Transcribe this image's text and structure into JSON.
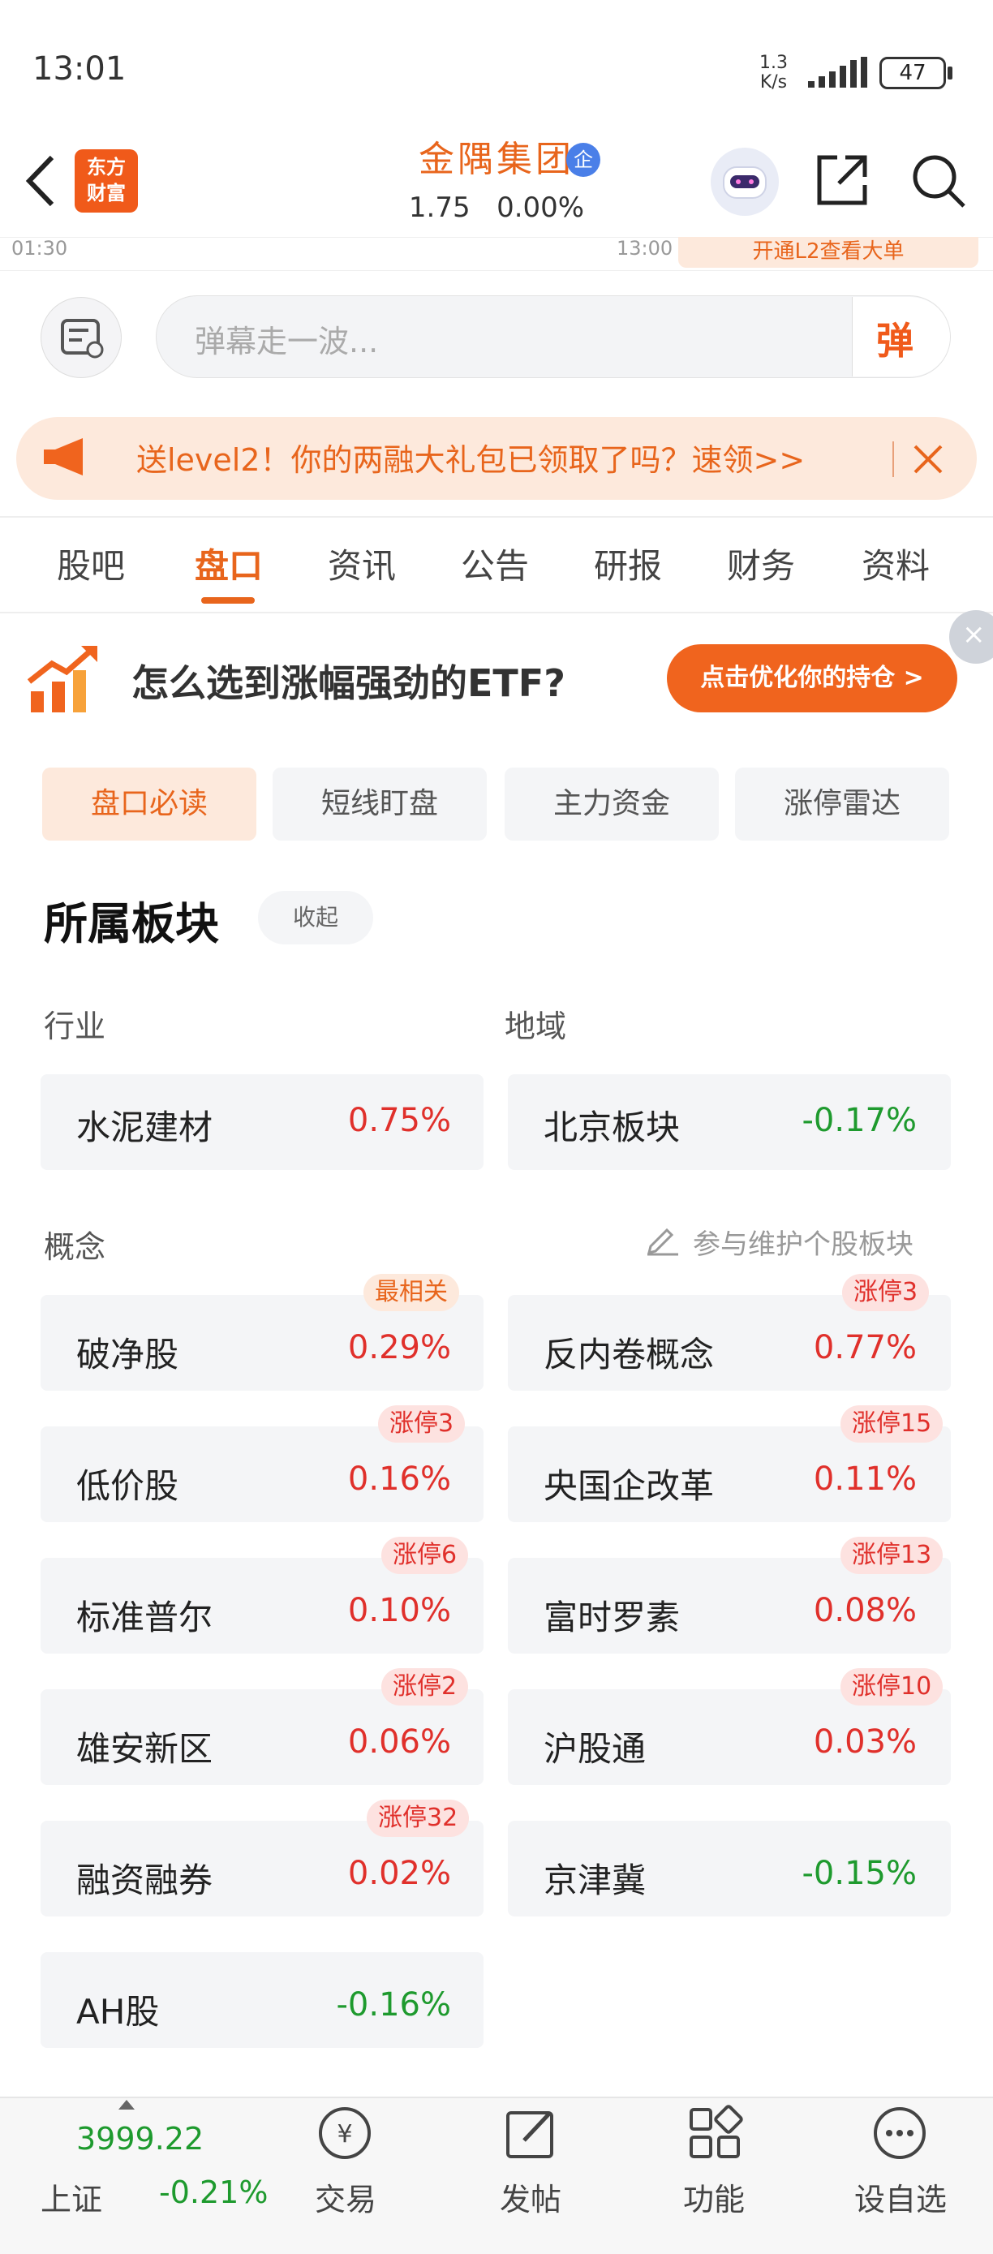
{
  "status_bar": {
    "time": "13:01",
    "net_speed_value": "1.3",
    "net_speed_unit": "K/s",
    "battery": "47"
  },
  "header": {
    "logo_line1": "东方",
    "logo_line2": "财富",
    "stock_name": "金隅集团",
    "badge": "企",
    "price": "1.75",
    "change": "0.00%"
  },
  "timeline": {
    "left_time": "01:30",
    "right_time": "13:00",
    "right_promo": "开通L2查看大单"
  },
  "danmu": {
    "placeholder": "弹幕走一波...",
    "button": "弹"
  },
  "promo": {
    "text": "送level2！你的两融大礼包已领取了吗？速领>>"
  },
  "tabs": [
    "股吧",
    "盘口",
    "资讯",
    "公告",
    "研报",
    "财务",
    "资料"
  ],
  "active_tab": "盘口",
  "ad": {
    "text": "怎么选到涨幅强劲的ETF?",
    "button": "点击优化你的持仓 >"
  },
  "subtabs": [
    "盘口必读",
    "短线盯盘",
    "主力资金",
    "涨停雷达"
  ],
  "section": {
    "title": "所属板块",
    "fold": "收起"
  },
  "industry": {
    "label": "行业",
    "name": "水泥建材",
    "value": "0.75%"
  },
  "region": {
    "label": "地域",
    "name": "北京板块",
    "value": "-0.17%"
  },
  "concept": {
    "label": "概念",
    "maintain": "参与维护个股板块",
    "items": [
      {
        "name": "破净股",
        "value": "0.29%",
        "badge": "最相关"
      },
      {
        "name": "反内卷概念",
        "value": "0.77%",
        "badge": "涨停3"
      },
      {
        "name": "低价股",
        "value": "0.16%",
        "badge": "涨停3"
      },
      {
        "name": "央国企改革",
        "value": "0.11%",
        "badge": "涨停15"
      },
      {
        "name": "标准普尔",
        "value": "0.10%",
        "badge": "涨停6"
      },
      {
        "name": "富时罗素",
        "value": "0.08%",
        "badge": "涨停13"
      },
      {
        "name": "雄安新区",
        "value": "0.06%",
        "badge": "涨停2"
      },
      {
        "name": "沪股通",
        "value": "0.03%",
        "badge": "涨停10"
      },
      {
        "name": "融资融券",
        "value": "0.02%",
        "badge": "涨停32"
      },
      {
        "name": "京津冀",
        "value": "-0.15%",
        "badge": ""
      },
      {
        "name": "AH股",
        "value": "-0.16%",
        "badge": ""
      }
    ]
  },
  "bottom_bar": {
    "index_value": "3999.22",
    "index_name": "上证",
    "index_change": "-0.21%",
    "items": [
      "交易",
      "发帖",
      "功能",
      "设自选"
    ]
  },
  "colors": {
    "accent": "#e8651c",
    "up": "#e0302b",
    "down": "#1e9a2e"
  }
}
